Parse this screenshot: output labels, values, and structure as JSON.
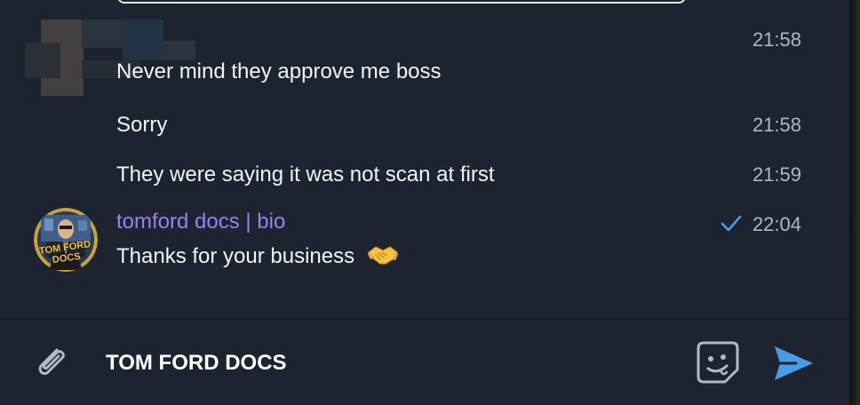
{
  "messages": [
    {
      "text": "Never mind they approve me boss",
      "time": "21:58"
    },
    {
      "text": "Sorry",
      "time": "21:58"
    },
    {
      "text": "They were saying it was not scan at first",
      "time": "21:59"
    }
  ],
  "last_message": {
    "author": "tomford docs | bio",
    "text": "Thanks for your business",
    "time": "22:04",
    "avatar_text": "TOM FORD DOCS",
    "status_icon": "single-check-icon",
    "emoji": "handshake-icon"
  },
  "composer": {
    "input_value": "TOM FORD DOCS",
    "attach_icon": "paperclip-icon",
    "emoji_icon": "sticker-icon",
    "send_icon": "send-icon"
  },
  "colors": {
    "background": "#1d2430",
    "author": "#9d7df2",
    "time": "#aeb6c2",
    "accent": "#4a9be8"
  }
}
